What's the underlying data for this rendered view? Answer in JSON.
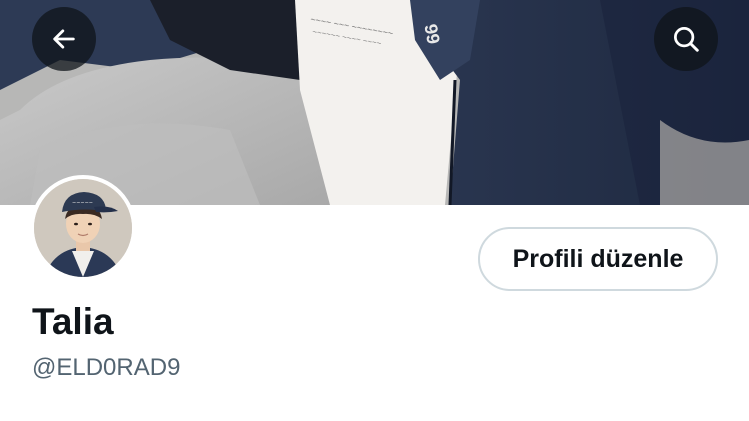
{
  "header": {
    "back_icon": "arrow-left-icon",
    "search_icon": "search-icon",
    "button_bg": "#0f1419"
  },
  "profile": {
    "display_name": "Talia",
    "handle": "@ELD0RAD9",
    "edit_button_label": "Profili düzenle"
  },
  "colors": {
    "text_primary": "#0f1419",
    "text_secondary": "#536471",
    "button_border": "#cfd9de",
    "background": "#ffffff"
  }
}
